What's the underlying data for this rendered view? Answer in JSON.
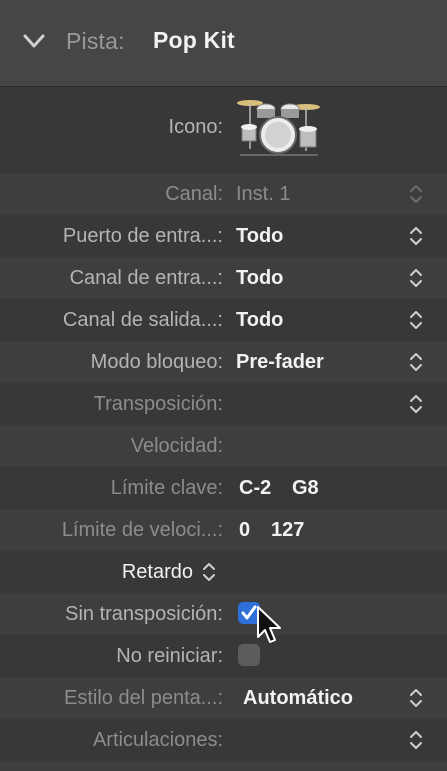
{
  "header": {
    "track_label": "Pista:",
    "track_name": "Pop Kit"
  },
  "rows": {
    "icon": {
      "label": "Icono:"
    },
    "channel": {
      "label": "Canal:",
      "value": "Inst. 1"
    },
    "input_port": {
      "label": "Puerto de entra...:",
      "value": "Todo"
    },
    "input_channel": {
      "label": "Canal de entra...:",
      "value": "Todo"
    },
    "output_channel": {
      "label": "Canal de salida...:",
      "value": "Todo"
    },
    "freeze_mode": {
      "label": "Modo bloqueo:",
      "value": "Pre-fader"
    },
    "transpose": {
      "label": "Transposición:"
    },
    "velocity": {
      "label": "Velocidad:"
    },
    "key_limit": {
      "label": "Límite clave:",
      "low": "C-2",
      "high": "G8"
    },
    "velocity_limit": {
      "label": "Límite de veloci...:",
      "low": "0",
      "high": "127"
    },
    "delay": {
      "label": "Retardo"
    },
    "no_transpose": {
      "label": "Sin transposición:",
      "checked": true
    },
    "no_reset": {
      "label": "No reiniciar:",
      "checked": false
    },
    "staff_style": {
      "label": "Estilo del penta...:",
      "value": "Automático"
    },
    "articulations": {
      "label": "Articulaciones:"
    }
  },
  "icons": {
    "chevron": "chevron-down-icon",
    "track_icon": "drum-kit-icon",
    "stepper": "up-down-stepper-icon",
    "checkmark": "checkmark-icon",
    "cursor": "mouse-pointer-icon"
  },
  "colors": {
    "checkbox_on": "#2f6fd9",
    "background": "#383838",
    "header": "#464646"
  }
}
